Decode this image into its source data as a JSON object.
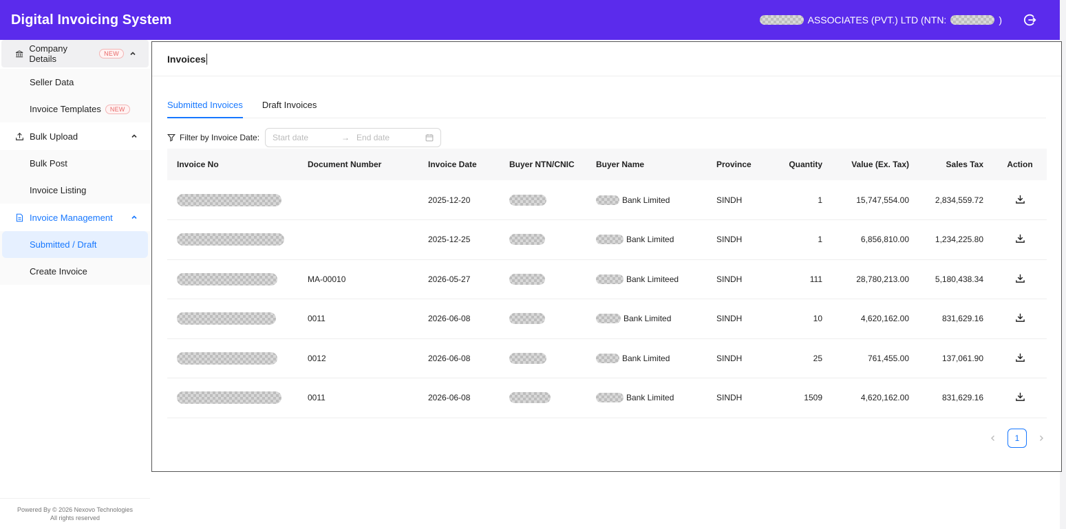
{
  "header": {
    "app_title": "Digital Invoicing System",
    "company_name": "ASSOCIATES (PVT.) LTD (NTN:",
    "company_suffix": ")"
  },
  "sidebar": {
    "groups": [
      {
        "label": "Company Details",
        "badge": "NEW",
        "icon": "bank-icon",
        "items": [
          {
            "label": "Seller Data"
          },
          {
            "label": "Invoice Templates",
            "badge": "NEW"
          }
        ]
      },
      {
        "label": "Bulk Upload",
        "icon": "upload-icon",
        "items": [
          {
            "label": "Bulk Post"
          },
          {
            "label": "Invoice Listing"
          }
        ]
      },
      {
        "label": "Invoice Management",
        "icon": "file-icon",
        "items": [
          {
            "label": "Submitted / Draft"
          },
          {
            "label": "Create Invoice"
          }
        ]
      }
    ],
    "footer_line1": "Powered By © 2026 Nexovo Technologies",
    "footer_line2": "All rights reserved"
  },
  "main": {
    "title": "Invoices",
    "tabs": [
      {
        "label": "Submitted Invoices"
      },
      {
        "label": "Draft Invoices"
      }
    ],
    "filter": {
      "label": "Filter by Invoice Date:",
      "start_placeholder": "Start date",
      "end_placeholder": "End date"
    },
    "table": {
      "columns": [
        "Invoice No",
        "Document Number",
        "Invoice Date",
        "Buyer NTN/CNIC",
        "Buyer Name",
        "Province",
        "Quantity",
        "Value (Ex. Tax)",
        "Sales Tax",
        "Action"
      ],
      "rows": [
        {
          "doc": "",
          "date": "2025-12-20",
          "buyer": "Bank Limited",
          "province": "SINDH",
          "qty": "1",
          "value": "15,747,554.00",
          "tax": "2,834,559.72"
        },
        {
          "doc": "",
          "date": "2025-12-25",
          "buyer": "Bank Limited",
          "province": "SINDH",
          "qty": "1",
          "value": "6,856,810.00",
          "tax": "1,234,225.80"
        },
        {
          "doc": "MA-00010",
          "date": "2026-05-27",
          "buyer": "Bank Limiteed",
          "province": "SINDH",
          "qty": "111",
          "value": "28,780,213.00",
          "tax": "5,180,438.34"
        },
        {
          "doc": "0011",
          "date": "2026-06-08",
          "buyer": "Bank Limited",
          "province": "SINDH",
          "qty": "10",
          "value": "4,620,162.00",
          "tax": "831,629.16"
        },
        {
          "doc": "0012",
          "date": "2026-06-08",
          "buyer": "Bank Limited",
          "province": "SINDH",
          "qty": "25",
          "value": "761,455.00",
          "tax": "137,061.90"
        },
        {
          "doc": "0011",
          "date": "2026-06-08",
          "buyer": "Bank Limited",
          "province": "SINDH",
          "qty": "1509",
          "value": "4,620,162.00",
          "tax": "831,629.16"
        }
      ]
    },
    "pagination": {
      "current": "1"
    }
  },
  "colors": {
    "brand": "#5b2bec",
    "accent": "#1677ff",
    "badge": "#e86a6a"
  }
}
